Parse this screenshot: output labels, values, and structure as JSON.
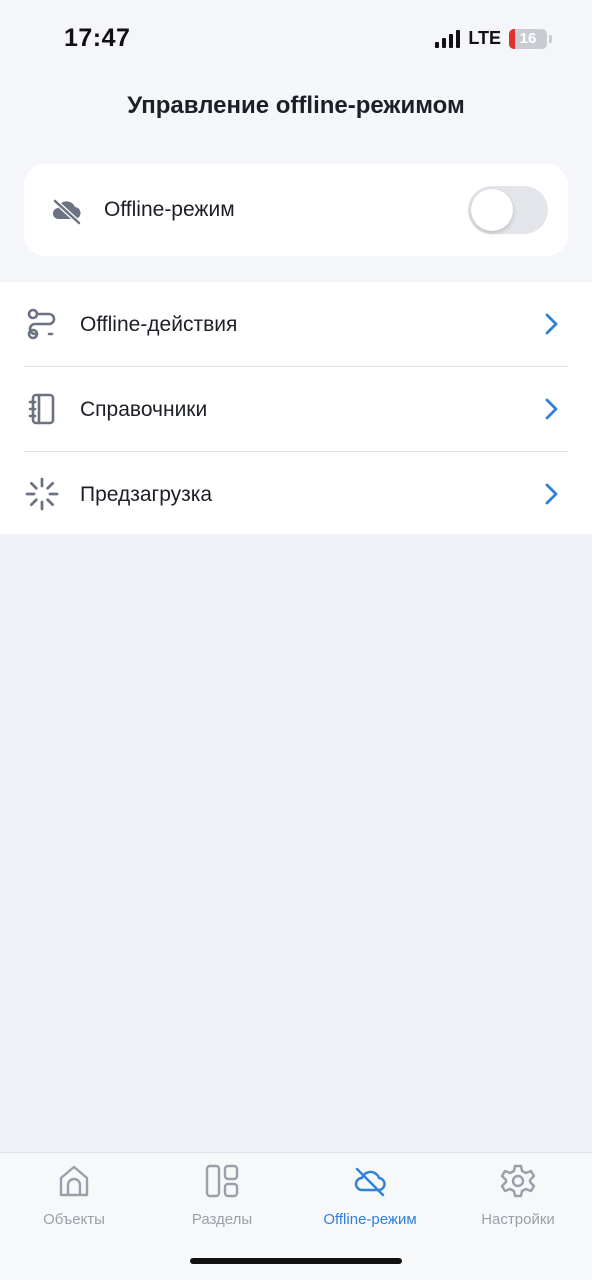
{
  "status_bar": {
    "time": "17:47",
    "network": "LTE",
    "battery": "16"
  },
  "page": {
    "title": "Управление offline-режимом"
  },
  "offline_mode": {
    "label": "Offline-режим",
    "enabled": false,
    "icon": "cloud-off-icon"
  },
  "menu": {
    "items": [
      {
        "label": "Offline-действия",
        "icon": "route-icon"
      },
      {
        "label": "Справочники",
        "icon": "notebook-icon"
      },
      {
        "label": "Предзагрузка",
        "icon": "loader-icon"
      }
    ]
  },
  "tabbar": {
    "tabs": [
      {
        "label": "Объекты",
        "icon": "home-icon",
        "active": false
      },
      {
        "label": "Разделы",
        "icon": "grid-icon",
        "active": false
      },
      {
        "label": "Offline-режим",
        "icon": "cloud-off-icon",
        "active": true
      },
      {
        "label": "Настройки",
        "icon": "gear-icon",
        "active": false
      }
    ]
  },
  "colors": {
    "accent": "#2f80d9",
    "icon_gray": "#6b7282",
    "background": "#eef1f5"
  }
}
